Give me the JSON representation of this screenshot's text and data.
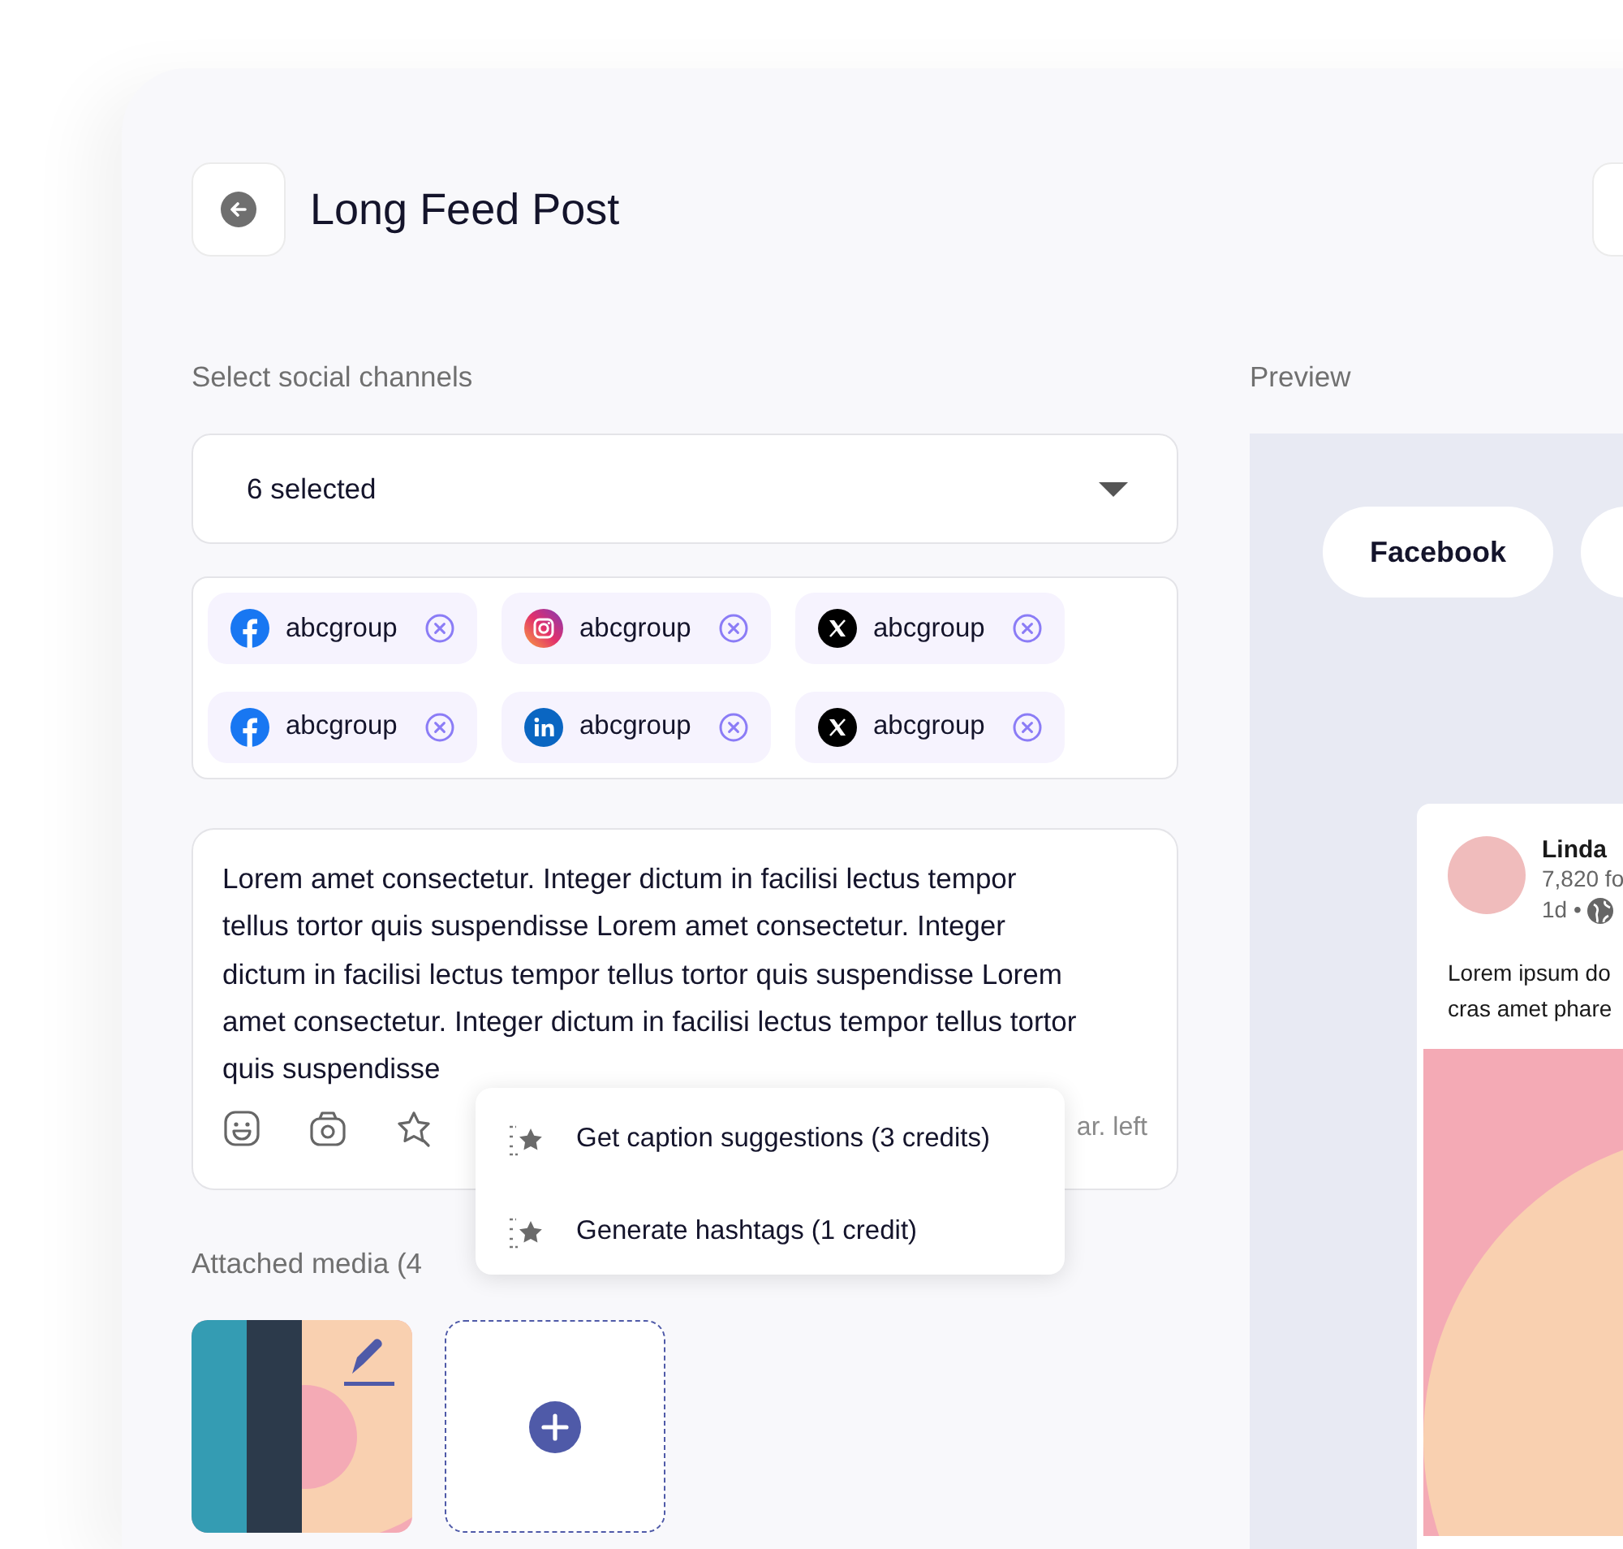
{
  "header": {
    "title": "Long Feed Post"
  },
  "channels": {
    "label": "Select social channels",
    "dropdown_value": "6 selected",
    "accounts": [
      {
        "kind": "facebook",
        "name": "abcgroup"
      },
      {
        "kind": "instagram",
        "name": "abcgroup"
      },
      {
        "kind": "x",
        "name": "abcgroup"
      },
      {
        "kind": "facebook",
        "name": "abcgroup"
      },
      {
        "kind": "linkedin",
        "name": "abcgroup"
      },
      {
        "kind": "x",
        "name": "abcgroup"
      }
    ]
  },
  "composer": {
    "text": "Lorem amet consectetur. Integer dictum in facilisi lectus tempor tellus tortor quis suspendisse Lorem amet consectetur. Integer dictum in facilisi lectus tempor tellus tortor quis suspendisse Lorem amet consectetur. Integer dictum in facilisi lectus tempor tellus tortor quis suspendisse",
    "counter": "ar. left"
  },
  "ai_menu": {
    "items": [
      "Get caption suggestions (3 credits)",
      "Generate hashtags (1 credit)"
    ]
  },
  "media": {
    "label": "Attached media (4"
  },
  "preview": {
    "label": "Preview",
    "tabs": [
      {
        "label": "Facebook",
        "selected": true
      }
    ],
    "post": {
      "author": "Linda",
      "followers": "7,820 fo",
      "time": "1d •",
      "text_lines": [
        "Lorem ipsum do",
        "cras amet phare"
      ]
    }
  }
}
